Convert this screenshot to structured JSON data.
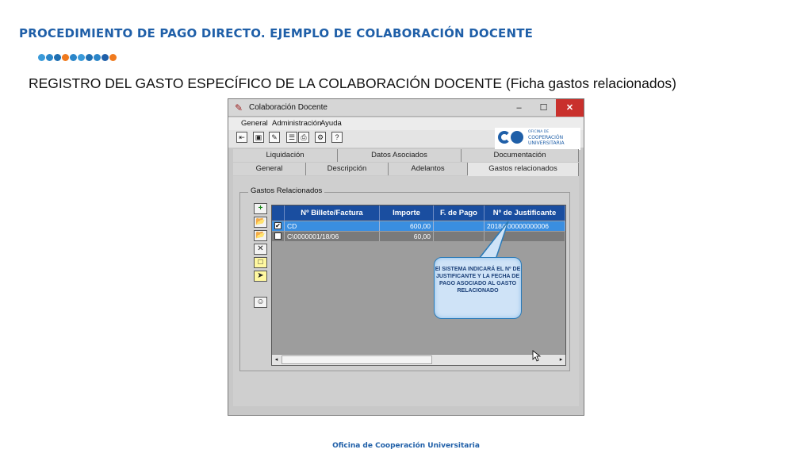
{
  "slide": {
    "title": "PROCEDIMIENTO DE PAGO DIRECTO. EJEMPLO DE COLABORACIÓN DOCENTE",
    "subtitle": "REGISTRO DEL GASTO ESPECÍFICO DE LA COLABORACIÓN DOCENTE (Ficha gastos relacionados)",
    "footer": "Oficina de Cooperación Universitaria",
    "dot_colors": [
      "#3a9ad9",
      "#2b86c9",
      "#1f6fb2",
      "#f07a1e",
      "#2b86c9",
      "#3a9ad9",
      "#1f6fb2",
      "#2b86c9",
      "#1f5fa8",
      "#f07a1e"
    ]
  },
  "window": {
    "title": "Colaboración Docente",
    "minimize": "–",
    "maximize": "☐",
    "close": "✕",
    "menu": [
      "General",
      "Administración",
      "Ayuda"
    ],
    "logo_small": "OFICINA DE",
    "logo_text": "COOPERACIÓN UNIVERSITARIA"
  },
  "tabs": {
    "row1": [
      "Liquidación",
      "Datos Asociados",
      "Documentación"
    ],
    "row2": [
      "General",
      "Descripción",
      "Adelantos",
      "Gastos relacionados"
    ],
    "active": "Gastos relacionados"
  },
  "group": {
    "label": "Gastos Relacionados"
  },
  "grid": {
    "columns": [
      "Nº Billete/Factura",
      "Importe",
      "F. de Pago",
      "Nº de Justificante"
    ],
    "rows": [
      {
        "checked": "✔",
        "billete": "CD",
        "importe": "600,00",
        "fecha": "",
        "justificante": "2018/000000000006"
      },
      {
        "checked": "",
        "billete": "C\\0000001/18/06",
        "importe": "60,00",
        "fecha": "",
        "justificante": ""
      }
    ],
    "scroll_left": "◂",
    "scroll_right": "▸"
  },
  "callout": {
    "text": "El SISTEMA INDICARÁ EL Nº DE JUSTIFICANTE Y LA FECHA DE PAGO ASOCIADO AL GASTO RELACIONADO"
  },
  "icons": [
    "add-icon",
    "open-folder-icon",
    "open-folder-icon",
    "delete-icon",
    "new-document-icon",
    "edit-document-icon",
    "search-user-icon"
  ]
}
